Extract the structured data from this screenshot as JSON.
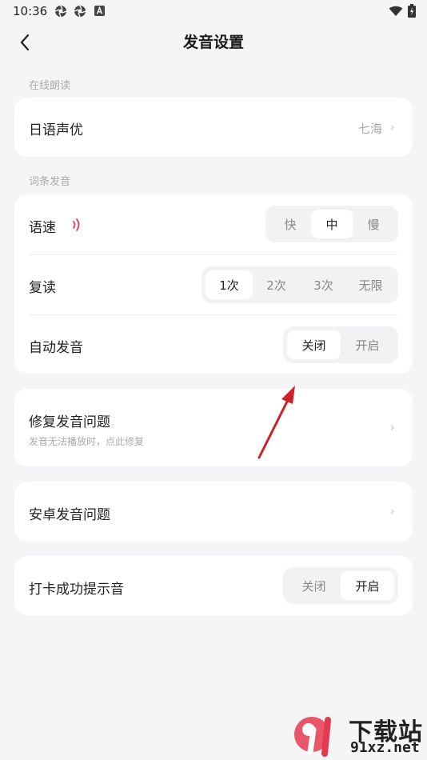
{
  "status_bar": {
    "time": "10:36",
    "icons_left": [
      "aperture-icon",
      "aperture-icon",
      "a-badge-icon"
    ],
    "icons_right": [
      "wifi-icon",
      "battery-icon"
    ]
  },
  "header": {
    "title": "发音设置",
    "back_icon": "back-arrow-icon"
  },
  "sections": {
    "online_reading": {
      "label": "在线朗读",
      "voice_actor": {
        "label": "日语声优",
        "value": "七海"
      }
    },
    "entry_pronunciation": {
      "label": "词条发音",
      "speed": {
        "label": "语速",
        "options": [
          "快",
          "中",
          "慢"
        ],
        "selected": "中",
        "sound_icon": "sound-wave-icon"
      },
      "repeat": {
        "label": "复读",
        "options": [
          "1次",
          "2次",
          "3次",
          "无限"
        ],
        "selected": "1次"
      },
      "auto_play": {
        "label": "自动发音",
        "options": [
          "关闭",
          "开启"
        ],
        "selected": "关闭"
      }
    },
    "fix_issue": {
      "label": "修复发音问题",
      "sublabel": "发音无法播放时，点此修复"
    },
    "android_issue": {
      "label": "安卓发音问题"
    },
    "checkin_sound": {
      "label": "打卡成功提示音",
      "options": [
        "关闭",
        "开启"
      ],
      "selected": "开启"
    }
  },
  "watermark": {
    "text": "下载站",
    "url": "91xz.net"
  },
  "colors": {
    "accent_red": "#e53950",
    "arrow_red": "#d0202a",
    "background": "#f5f5f7"
  }
}
